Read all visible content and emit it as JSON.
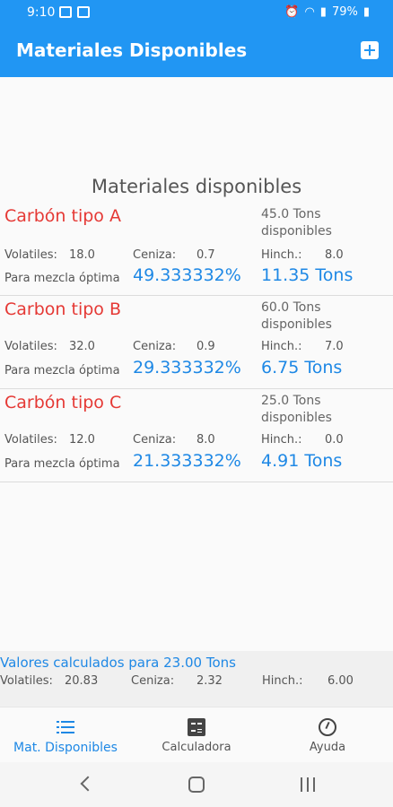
{
  "status_bar": {
    "time": "9:10",
    "battery": "79%"
  },
  "app_bar": {
    "title": "Materiales Disponibles",
    "add_icon": "add-box-icon"
  },
  "section_title": "Materiales disponibles",
  "labels": {
    "volatiles": "Volatiles:",
    "ceniza": "Ceniza:",
    "hinch": "Hinch.:",
    "mezcla": "Para mezcla óptima"
  },
  "materials": [
    {
      "name": "Carbón tipo A",
      "available_line1": "45.0 Tons",
      "available_line2": "disponibles",
      "volatiles": "18.0",
      "ceniza": "0.7",
      "hinch": "8.0",
      "percent": "49.333332%",
      "tons": "11.35 Tons"
    },
    {
      "name": "Carbon tipo B",
      "available_line1": "60.0 Tons",
      "available_line2": "disponibles",
      "volatiles": "32.0",
      "ceniza": "0.9",
      "hinch": "7.0",
      "percent": "29.333332%",
      "tons": "6.75 Tons"
    },
    {
      "name": "Carbón tipo C",
      "available_line1": "25.0 Tons",
      "available_line2": "disponibles",
      "volatiles": "12.0",
      "ceniza": "8.0",
      "hinch": "0.0",
      "percent": "21.333332%",
      "tons": "4.91 Tons"
    }
  ],
  "summary": {
    "title": "Valores calculados para 23.00 Tons",
    "volatiles": "20.83",
    "ceniza": "2.32",
    "hinch": "6.00"
  },
  "bottom_nav": [
    {
      "label": "Mat. Disponibles",
      "icon": "list-icon",
      "active": true
    },
    {
      "label": "Calculadora",
      "icon": "calculator-icon",
      "active": false
    },
    {
      "label": "Ayuda",
      "icon": "help-icon",
      "active": false
    }
  ],
  "colors": {
    "primary": "#2196f3",
    "accent_blue": "#1e88e5",
    "name_red": "#e53935"
  }
}
